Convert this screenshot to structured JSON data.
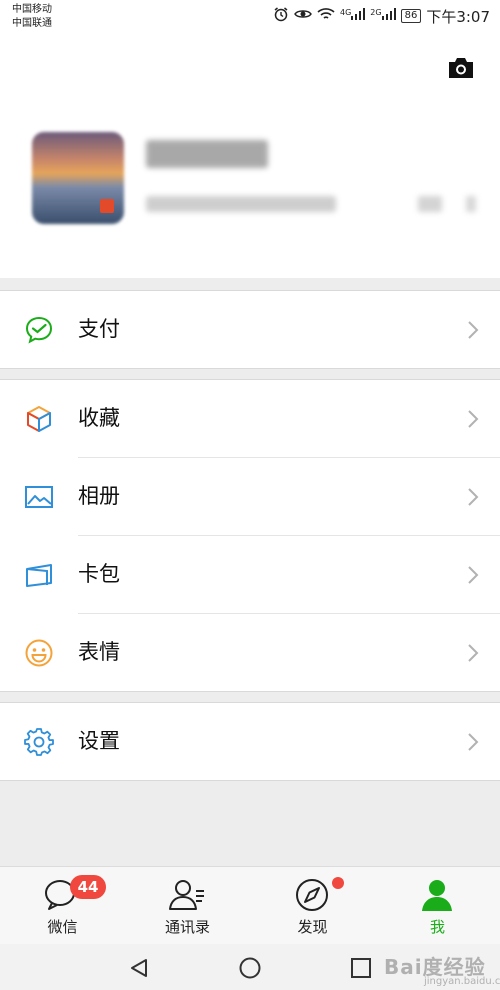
{
  "status_bar": {
    "carrier_1": "中国移动",
    "carrier_2": "中国联通",
    "net_1": "4G",
    "net_2": "2G",
    "battery": "86",
    "time": "下午3:07"
  },
  "menu": {
    "pay": "支付",
    "favorites": "收藏",
    "album": "相册",
    "cards": "卡包",
    "stickers": "表情",
    "settings": "设置"
  },
  "tabs": [
    {
      "label": "微信",
      "badge": "44"
    },
    {
      "label": "通讯录"
    },
    {
      "label": "发现"
    },
    {
      "label": "我"
    }
  ],
  "watermark": "Bai度经验",
  "watermark_sub": "jingyan.baidu.com",
  "colors": {
    "accent": "#1aad19",
    "badge": "#f0483e",
    "pay_icon": "#1aad19",
    "photo_icon": "#2f8fd8",
    "card_icon": "#2f8fd8",
    "emoji_icon": "#f3a33a",
    "settings_icon": "#2f8fd8"
  }
}
